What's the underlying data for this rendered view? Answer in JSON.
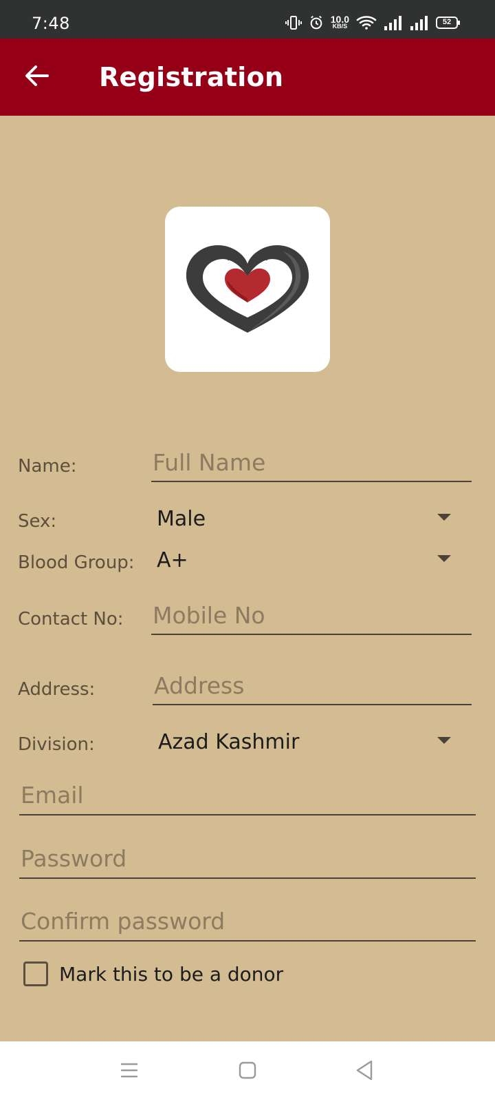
{
  "status_bar": {
    "time": "7:48",
    "net_speed_value": "10.0",
    "net_speed_unit": "KB/S",
    "battery": "52",
    "icons": [
      "vibrate-icon",
      "alarm-icon",
      "wifi-icon",
      "signal-icon",
      "signal-icon",
      "battery-icon"
    ]
  },
  "app_bar": {
    "title": "Registration",
    "back_icon": "arrow-left-icon",
    "color": "#960016"
  },
  "logo": {
    "icon": "heart-hands-logo"
  },
  "form": {
    "name_label": "Name:",
    "name_placeholder": "Full Name",
    "sex_label": "Sex:",
    "sex_value": "Male",
    "blood_group_label": "Blood Group:",
    "blood_group_value": "A+",
    "contact_label": "Contact No:",
    "contact_placeholder": "Mobile No",
    "address_label": "Address:",
    "address_placeholder": "Address",
    "division_label": "Division:",
    "division_value": "Azad Kashmir",
    "email_placeholder": "Email",
    "password_placeholder": "Password",
    "confirm_password_placeholder": "Confirm password",
    "donor_checkbox_label": "Mark this to be a donor",
    "donor_checked": false
  },
  "nav_bar": {
    "icons": [
      "menu-icon",
      "home-icon",
      "back-icon"
    ]
  },
  "colors": {
    "background": "#d3bc91",
    "app_bar": "#960016",
    "status_bar": "#303232"
  }
}
